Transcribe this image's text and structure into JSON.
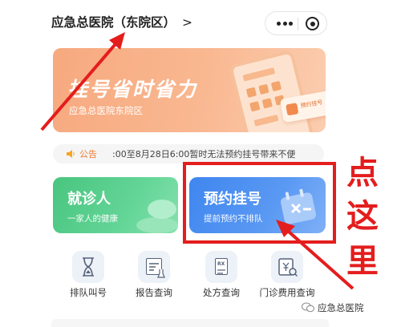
{
  "header": {
    "title": "应急总医院（东院区）",
    "chevron": ">"
  },
  "banner": {
    "title": "挂号省时省力",
    "subtitle": "应急总医院东院区",
    "card_label": "预约挂号"
  },
  "notice": {
    "label": "公告",
    "text": ":00至8月28日6:00暂时无法预约挂号带来不便"
  },
  "cards": {
    "visit": {
      "title": "就诊人",
      "subtitle": "一家人的健康"
    },
    "register": {
      "title": "预约挂号",
      "subtitle": "提前预约不排队"
    }
  },
  "annotation": {
    "chars": [
      "点",
      "这",
      "里"
    ],
    "color": "#e41d1d"
  },
  "services": [
    {
      "label": "排队叫号",
      "icon": "hourglass-icon"
    },
    {
      "label": "报告查询",
      "icon": "report-icon"
    },
    {
      "label": "处方查询",
      "icon": "prescription-icon"
    },
    {
      "label": "门诊费用查询",
      "icon": "fee-icon"
    }
  ],
  "prescription_badge": "RX",
  "watermark": "应急总医院",
  "colors": {
    "banner": "#f7a97f",
    "green_card": "#49c57f",
    "blue_card": "#3f86ef",
    "notice_label": "#f07b33"
  }
}
